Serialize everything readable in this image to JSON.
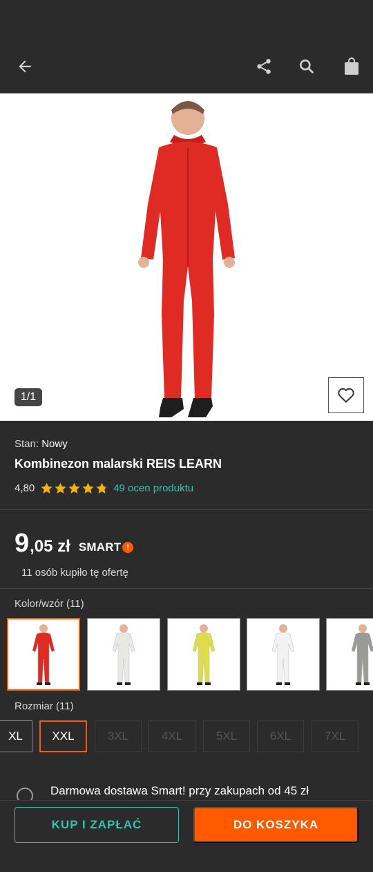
{
  "gallery": {
    "counter": "1/1"
  },
  "product": {
    "condition_label": "Stan:",
    "condition_value": "Nowy",
    "title": "Kombinezon malarski REIS LEARN",
    "rating": "4,80",
    "rating_value": 4.8,
    "reviews": "49 ocen produktu",
    "price_int": "9",
    "price_rest": ",05 zł",
    "smart_label": "SMART",
    "bought": "11 osób kupiło tę ofertę"
  },
  "colors": {
    "label": "Kolor/wzór (11)",
    "items": [
      {
        "name": "red",
        "hex": "#e02a24"
      },
      {
        "name": "white-hood",
        "hex": "#e8e8e4"
      },
      {
        "name": "yellow",
        "hex": "#e0db4a"
      },
      {
        "name": "white-red",
        "hex": "#f2f2f2"
      },
      {
        "name": "grey",
        "hex": "#9a9a96"
      }
    ]
  },
  "sizes": {
    "label": "Rozmiar (11)",
    "items": [
      "XL",
      "XXL",
      "3XL",
      "4XL",
      "5XL",
      "6XL",
      "7XL"
    ]
  },
  "delivery": {
    "text": "Darmowa dostawa Smart! przy zakupach od 45 zł"
  },
  "actions": {
    "buy": "KUP I ZAPŁAĆ",
    "cart": "DO KOSZYKA"
  },
  "theme": {
    "accent": "#ff5a00",
    "teal": "#32c3b4",
    "star": "#f5b400"
  }
}
